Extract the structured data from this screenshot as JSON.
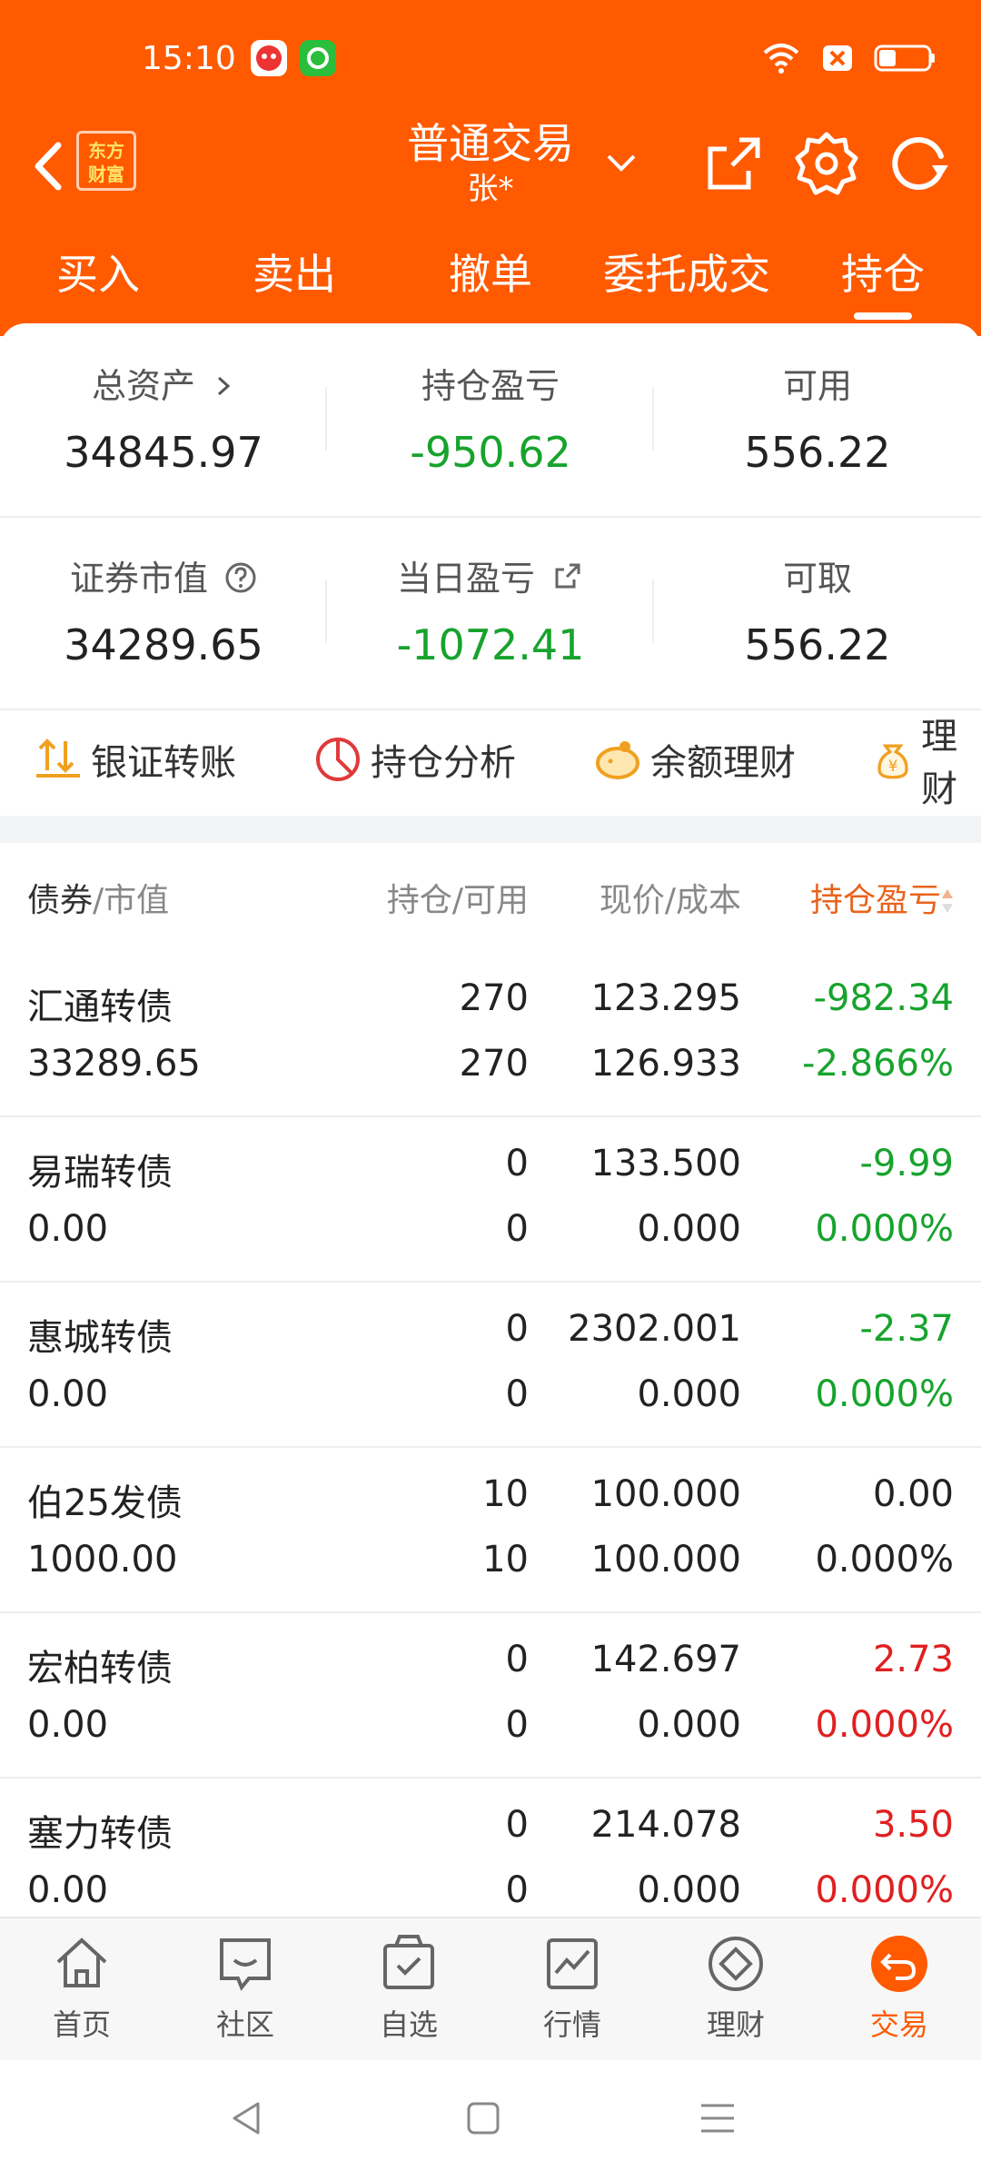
{
  "status_bar": {
    "time": "15:10"
  },
  "header": {
    "logo_text": "东方财富",
    "title": "普通交易",
    "account": "张*",
    "tabs": [
      {
        "label": "买入"
      },
      {
        "label": "卖出"
      },
      {
        "label": "撤单"
      },
      {
        "label": "委托成交"
      },
      {
        "label": "持仓",
        "active": true
      }
    ],
    "accent_color": "#ff5a00"
  },
  "summary": {
    "total_assets": {
      "label": "总资产",
      "value": "34845.97"
    },
    "position_pl": {
      "label": "持仓盈亏",
      "value": "-950.62"
    },
    "available": {
      "label": "可用",
      "value": "556.22"
    },
    "market_value": {
      "label": "证券市值",
      "value": "34289.65"
    },
    "daily_pl": {
      "label": "当日盈亏",
      "value": "-1072.41"
    },
    "withdrawable": {
      "label": "可取",
      "value": "556.22"
    }
  },
  "quick_actions": [
    {
      "label": "银证转账",
      "icon": "transfer-icon"
    },
    {
      "label": "持仓分析",
      "icon": "pie-chart-icon"
    },
    {
      "label": "余额理财",
      "icon": "piggy-bank-icon"
    },
    {
      "label": "理财",
      "icon": "money-bag-icon"
    }
  ],
  "table": {
    "headers": {
      "name_a": "债券",
      "name_b": "/市值",
      "qty": "持仓/可用",
      "price": "现价/成本",
      "pl": "持仓盈亏"
    },
    "rows": [
      {
        "name": "汇通转债",
        "market_value": "33289.65",
        "holding": "270",
        "available": "270",
        "price": "123.295",
        "cost": "126.933",
        "pl": "-982.34",
        "pl_pct": "-2.866%",
        "color": "green"
      },
      {
        "name": "易瑞转债",
        "market_value": "0.00",
        "holding": "0",
        "available": "0",
        "price": "133.500",
        "cost": "0.000",
        "pl": "-9.99",
        "pl_pct": "0.000%",
        "color": "green"
      },
      {
        "name": "惠城转债",
        "market_value": "0.00",
        "holding": "0",
        "available": "0",
        "price": "2302.001",
        "cost": "0.000",
        "pl": "-2.37",
        "pl_pct": "0.000%",
        "color": "green"
      },
      {
        "name": "伯25发债",
        "market_value": "1000.00",
        "holding": "10",
        "available": "10",
        "price": "100.000",
        "cost": "100.000",
        "pl": "0.00",
        "pl_pct": "0.000%",
        "color": "neutral"
      },
      {
        "name": "宏柏转债",
        "market_value": "0.00",
        "holding": "0",
        "available": "0",
        "price": "142.697",
        "cost": "0.000",
        "pl": "2.73",
        "pl_pct": "0.000%",
        "color": "red"
      },
      {
        "name": "塞力转债",
        "market_value": "0.00",
        "holding": "0",
        "available": "0",
        "price": "214.078",
        "cost": "0.000",
        "pl": "3.50",
        "pl_pct": "0.000%",
        "color": "red"
      }
    ]
  },
  "bottom_nav": [
    {
      "label": "首页",
      "icon": "home-icon"
    },
    {
      "label": "社区",
      "icon": "community-icon"
    },
    {
      "label": "自选",
      "icon": "watchlist-icon"
    },
    {
      "label": "行情",
      "icon": "market-chart-icon"
    },
    {
      "label": "理财",
      "icon": "wealth-icon"
    },
    {
      "label": "交易",
      "icon": "trade-icon",
      "active": true
    }
  ],
  "colors": {
    "gain": "#e02020",
    "loss": "#17a32d",
    "accent": "#ff5a00"
  }
}
